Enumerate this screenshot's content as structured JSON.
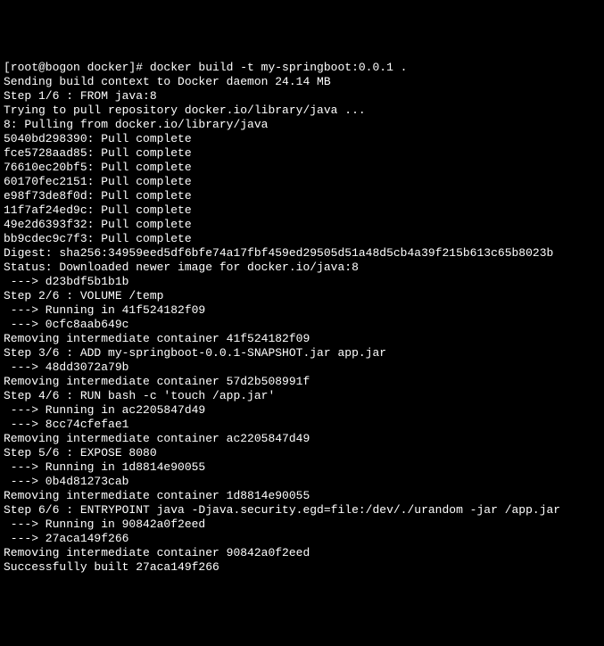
{
  "terminal": {
    "lines": [
      "[root@bogon docker]# docker build -t my-springboot:0.0.1 .",
      "Sending build context to Docker daemon 24.14 MB",
      "Step 1/6 : FROM java:8",
      "Trying to pull repository docker.io/library/java ...",
      "8: Pulling from docker.io/library/java",
      "5040bd298390: Pull complete",
      "fce5728aad85: Pull complete",
      "76610ec20bf5: Pull complete",
      "60170fec2151: Pull complete",
      "e98f73de8f0d: Pull complete",
      "11f7af24ed9c: Pull complete",
      "49e2d6393f32: Pull complete",
      "bb9cdec9c7f3: Pull complete",
      "Digest: sha256:34959eed5df6bfe74a17fbf459ed29505d51a48d5cb4a39f215b613c65b8023b",
      "Status: Downloaded newer image for docker.io/java:8",
      " ---> d23bdf5b1b1b",
      "Step 2/6 : VOLUME /temp",
      " ---> Running in 41f524182f09",
      " ---> 0cfc8aab649c",
      "Removing intermediate container 41f524182f09",
      "Step 3/6 : ADD my-springboot-0.0.1-SNAPSHOT.jar app.jar",
      " ---> 48dd3072a79b",
      "Removing intermediate container 57d2b508991f",
      "Step 4/6 : RUN bash -c 'touch /app.jar'",
      " ---> Running in ac2205847d49",
      "",
      " ---> 8cc74cfefae1",
      "Removing intermediate container ac2205847d49",
      "Step 5/6 : EXPOSE 8080",
      " ---> Running in 1d8814e90055",
      " ---> 0b4d81273cab",
      "Removing intermediate container 1d8814e90055",
      "Step 6/6 : ENTRYPOINT java -Djava.security.egd=file:/dev/./urandom -jar /app.jar",
      " ---> Running in 90842a0f2eed",
      " ---> 27aca149f266",
      "Removing intermediate container 90842a0f2eed",
      "Successfully built 27aca149f266"
    ]
  }
}
